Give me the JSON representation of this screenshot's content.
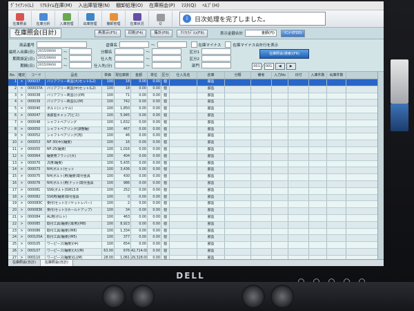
{
  "menu": [
    "ｸﾞﾗｲｱﾝﾄ(L)",
    "ﾘｱﾙﾀｲﾑ在庫(M)",
    "入出庫管理(N)",
    "棚卸処理(O)",
    "在庫照会(P)",
    "ﾏｽﾀ(Q)",
    "ﾍﾙﾌﾟ(H)"
  ],
  "toolbar": [
    "在庫照会",
    "在庫分析",
    "入庫管理",
    "出庫管理",
    "棚卸管理",
    "在庫状況",
    "Q"
  ],
  "message": "日次処理を完了しました。",
  "window_title": "在庫照会(日計)",
  "actions": [
    "再表示(F5)",
    "印刷(F4)",
    "集計(F8)",
    "ｸﾘｱ(ﾓﾃﾞﾙ)(F9)",
    "ﾒﾆｭｰ(F10)"
  ],
  "summary": {
    "label": "表示金額合計",
    "value": "金額(円)"
  },
  "filters": {
    "row1": {
      "l1": "商品番号",
      "v1": "",
      "l2": "倉庫名",
      "v2": "",
      "c1": "在庫マイナス",
      "c2": "在庫マイナス合計行を表示"
    },
    "row2": {
      "l1": "最終入出庫(日)",
      "v1": "2015/09/04",
      "l2": "分類名",
      "v2": "",
      "l3": "区分1",
      "v3": ""
    },
    "row3": {
      "l1": "期首設定(日)",
      "v1": "2015/09/04",
      "l2": "仕入先",
      "v2": "",
      "l3": "区分2",
      "v3": ""
    },
    "row4": {
      "l1": "期間(日)",
      "v1": "2015/09/04",
      "l2": "仕入先(分)",
      "v2": "",
      "l3": "部門",
      "v3": ""
    }
  },
  "search_button": "在庫照会(検索)(F6)",
  "nav": {
    "page": "001",
    "total": "001"
  },
  "columns": [
    "No.",
    "確定",
    "コード",
    "品名",
    "単価",
    "現在庫数",
    "金額",
    "単位",
    "区分",
    "仕入先名",
    "倉庫",
    "分類",
    "備考",
    "入力No",
    "日付",
    "入庫件数",
    "出庫件数"
  ],
  "rows": [
    {
      "no": "1",
      "ed": ">",
      "code": "000037",
      "name": "バリアフリー商品(大)セット(L2)",
      "tanka": "100",
      "qty": "18",
      "amt": "0.00",
      "vs": "0.00",
      "kb": "個",
      "bunrui": "部品"
    },
    {
      "no": "2",
      "ed": ">",
      "code": "000037A",
      "name": "バリアフリー商品(中)セット(L2)",
      "tanka": "100",
      "qty": "18",
      "amt": "0.00",
      "vs": "0.00",
      "kb": "個",
      "bunrui": "部品"
    },
    {
      "no": "3",
      "ed": ">",
      "code": "000038",
      "name": "バリアフリー商品(小)(M)",
      "tanka": "100",
      "qty": "71",
      "amt": "0.00",
      "vs": "0.00",
      "kb": "個",
      "bunrui": "部品"
    },
    {
      "no": "4",
      "ed": ">",
      "code": "000039",
      "name": "バリアフリー商品(L)(M)",
      "tanka": "100",
      "qty": "742",
      "amt": "0.00",
      "vs": "0.00",
      "kb": "個",
      "bunrui": "部品"
    },
    {
      "no": "5",
      "ed": ">",
      "code": "000040",
      "name": "ボルト(ニッケル)",
      "tanka": "100",
      "qty": "1,850",
      "amt": "0.00",
      "vs": "0.00",
      "kb": "個",
      "bunrui": "部品"
    },
    {
      "no": "6",
      "ed": ">",
      "code": "000047",
      "name": "後部型キャップ(ビス)",
      "tanka": "100",
      "qty": "5,945",
      "amt": "0.00",
      "vs": "0.00",
      "kb": "個",
      "bunrui": "部品"
    },
    {
      "no": "7",
      "ed": ">",
      "code": "000048",
      "name": "シャフトベアリング",
      "tanka": "100",
      "qty": "1,632",
      "amt": "0.00",
      "vs": "0.00",
      "kb": "個",
      "bunrui": "部品"
    },
    {
      "no": "8",
      "ed": ">",
      "code": "000050",
      "name": "シャフトベアリング(調整軸)",
      "tanka": "100",
      "qty": "467",
      "amt": "0.00",
      "vs": "0.00",
      "kb": "個",
      "bunrui": "部品"
    },
    {
      "no": "9",
      "ed": ">",
      "code": "000052",
      "name": "シャフトベアリング(両)",
      "tanka": "100",
      "qty": "46",
      "amt": "0.00",
      "vs": "0.00",
      "kb": "個",
      "bunrui": "部品"
    },
    {
      "no": "10",
      "ed": ">",
      "code": "000053",
      "name": "NF-30(中)(軸受)",
      "tanka": "100",
      "qty": "16",
      "amt": "0.00",
      "vs": "0.00",
      "kb": "個",
      "bunrui": "部品"
    },
    {
      "no": "11",
      "ed": ">",
      "code": "000055",
      "name": "NF-25(軸受)",
      "tanka": "100",
      "qty": "1,016",
      "amt": "0.00",
      "vs": "0.00",
      "kb": "個",
      "bunrui": "部品"
    },
    {
      "no": "12",
      "ed": ">",
      "code": "000064",
      "name": "軸受用フランジ(大)",
      "tanka": "100",
      "qty": "404",
      "amt": "0.00",
      "vs": "0.00",
      "kb": "個",
      "bunrui": "部品"
    },
    {
      "no": "13",
      "ed": ">",
      "code": "000070",
      "name": "汎用(軸受)",
      "tanka": "100",
      "qty": "5,435",
      "amt": "0.00",
      "vs": "0.00",
      "kb": "個",
      "bunrui": "部品"
    },
    {
      "no": "14",
      "ed": ">",
      "code": "000073",
      "name": "NH(ボルト)セット",
      "tanka": "100",
      "qty": "3,436",
      "amt": "0.00",
      "vs": "0.00",
      "kb": "個",
      "bunrui": "部品"
    },
    {
      "no": "15",
      "ed": ">",
      "code": "000075",
      "name": "NH(ボルト)用(軸受)取付金具",
      "tanka": "100",
      "qty": "430",
      "amt": "0.00",
      "vs": "0.00",
      "kb": "個",
      "bunrui": "部品"
    },
    {
      "no": "16",
      "ed": ">",
      "code": "000076",
      "name": "NH(ボルト)用(ナット)取付金具",
      "tanka": "100",
      "qty": "986",
      "amt": "0.00",
      "vs": "0.00",
      "kb": "個",
      "bunrui": "部品"
    },
    {
      "no": "17",
      "ed": ">",
      "code": "000081",
      "name": "SS6(ボルト)SW13.8",
      "tanka": "100",
      "qty": "252",
      "amt": "0.00",
      "vs": "0.00",
      "kb": "個",
      "bunrui": "部品"
    },
    {
      "no": "18",
      "ed": ">",
      "code": "000082",
      "name": "SS6用(軸受)取付金具",
      "tanka": "100",
      "qty": "0",
      "amt": "0.00",
      "vs": "0.00",
      "kb": "個",
      "bunrui": "部品"
    },
    {
      "no": "19",
      "ed": ">",
      "code": "000083C",
      "name": "受付(セット)(ソケットレバー)",
      "tanka": "100",
      "qty": "2",
      "amt": "0.00",
      "vs": "0.00",
      "kb": "個",
      "bunrui": "部品"
    },
    {
      "no": "20",
      "ed": ">",
      "code": "000083K",
      "name": "受付(セット)(ホールドアップ)",
      "tanka": "100",
      "qty": "34",
      "amt": "0.00",
      "vs": "0.00",
      "kb": "個",
      "bunrui": "部品"
    },
    {
      "no": "21",
      "ed": ">",
      "code": "000084",
      "name": "AL用(ボルト)",
      "tanka": "100",
      "qty": "463",
      "amt": "0.00",
      "vs": "0.00",
      "kb": "個",
      "bunrui": "部品"
    },
    {
      "no": "22",
      "ed": ">",
      "code": "000085",
      "name": "取付工具(軸受)(専用)(M8)",
      "tanka": "100",
      "qty": "8,923",
      "amt": "0.00",
      "vs": "0.00",
      "kb": "個",
      "bunrui": "部品"
    },
    {
      "no": "23",
      "ed": ">",
      "code": "000086",
      "name": "取付工具(軸受)(M8)",
      "tanka": "100",
      "qty": "1,334",
      "amt": "0.00",
      "vs": "0.00",
      "kb": "個",
      "bunrui": "部品"
    },
    {
      "no": "24",
      "ed": ">",
      "code": "000105A",
      "name": "取付工具(軸受)(M5)",
      "tanka": "100",
      "qty": "377",
      "amt": "0.00",
      "vs": "0.00",
      "kb": "個",
      "bunrui": "部品"
    },
    {
      "no": "25",
      "ed": ">",
      "code": "000105",
      "name": "ワーピース(軸受)(中)",
      "tanka": "100",
      "qty": "654",
      "amt": "0.00",
      "vs": "0.00",
      "kb": "個",
      "bunrui": "部品"
    },
    {
      "no": "26",
      "ed": ">",
      "code": "000107",
      "name": "ワーピース(軸受)(大)(M)",
      "tanka": "63.00",
      "qty": "676",
      "amt": "42,714.00",
      "vs": "0.00",
      "kb": "個",
      "bunrui": "部品"
    },
    {
      "no": "27",
      "ed": ">",
      "code": "000110",
      "name": "ワーピース(軸受)(L)(M)",
      "tanka": "28.00",
      "qty": "1,061",
      "amt": "29,328.00",
      "vs": "0.00",
      "kb": "個",
      "bunrui": "部品"
    },
    {
      "no": "28",
      "ed": ">",
      "code": "000113",
      "name": "汎用(軸受)(ソケットレバー)",
      "tanka": "100",
      "qty": "386",
      "amt": "0.00",
      "vs": "0.00",
      "kb": "個",
      "bunrui": "部品"
    },
    {
      "no": "29",
      "ed": ">",
      "code": "000114",
      "name": "汎用(軸受)(ソケット)(POM)",
      "tanka": "100",
      "qty": "543",
      "amt": "0.00",
      "vs": "0.00",
      "kb": "個",
      "bunrui": "部品"
    },
    {
      "no": "30",
      "ed": ">",
      "code": "000117",
      "name": "汎用(軸受)(ソケットレバー)",
      "tanka": "100",
      "qty": "137",
      "amt": "0.00",
      "vs": "0.00",
      "kb": "個",
      "bunrui": "部品"
    }
  ],
  "status_tabs": [
    "在庫照会(日計)",
    "在庫照会(日計)"
  ],
  "monitor_brand": "DELL"
}
